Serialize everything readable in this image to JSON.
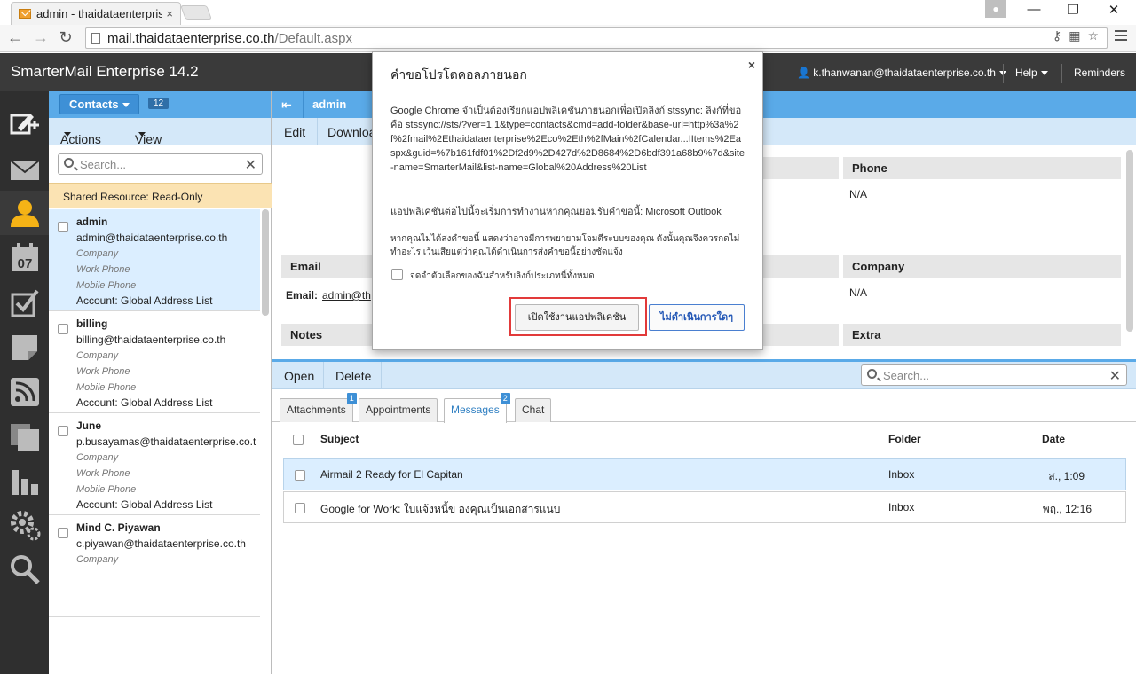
{
  "browser": {
    "tab_title": "admin - thaidataenterprise",
    "tab_close": "×",
    "url_host": "mail.thaidataenterprise.co.th",
    "url_path": "/Default.aspx"
  },
  "app": {
    "title": "SmarterMail Enterprise 14.2",
    "user": "k.thanwanan@thaidataenterprise.co.th",
    "help": "Help",
    "reminders": "Reminders"
  },
  "rail": {
    "calendar_day": "07"
  },
  "contacts": {
    "button_label": "Contacts",
    "count": "12",
    "actions": "Actions",
    "view": "View",
    "search_placeholder": "Search...",
    "shared_notice": "Shared Resource: Read-Only",
    "items": [
      {
        "name": "admin",
        "email": "admin@thaidataenterprise.co.th",
        "company": "Company",
        "work_phone": "Work Phone",
        "mobile_phone": "Mobile Phone",
        "account": "Account: Global Address List"
      },
      {
        "name": "billing",
        "email": "billing@thaidataenterprise.co.th",
        "company": "Company",
        "work_phone": "Work Phone",
        "mobile_phone": "Mobile Phone",
        "account": "Account: Global Address List"
      },
      {
        "name": "June",
        "email": "p.busayamas@thaidataenterprise.co.t",
        "company": "Company",
        "work_phone": "Work Phone",
        "mobile_phone": "Mobile Phone",
        "account": "Account: Global Address List"
      },
      {
        "name": "Mind C. Piyawan",
        "email": "c.piyawan@thaidataenterprise.co.th",
        "company": "Company",
        "work_phone": "",
        "mobile_phone": "",
        "account": ""
      }
    ]
  },
  "detail": {
    "title": "admin",
    "edit": "Edit",
    "download": "Download",
    "phone_header": "Phone",
    "phone_value": "N/A",
    "email_header": "Email",
    "email_label": "Email:",
    "email_value": "admin@th",
    "company_header": "Company",
    "company_value": "N/A",
    "notes_header": "Notes",
    "extra_header": "Extra"
  },
  "lower": {
    "open": "Open",
    "delete": "Delete",
    "search_placeholder": "Search...",
    "tabs": [
      {
        "label": "Attachments",
        "badge": "1"
      },
      {
        "label": "Appointments",
        "badge": ""
      },
      {
        "label": "Messages",
        "badge": "2"
      },
      {
        "label": "Chat",
        "badge": ""
      }
    ],
    "columns": {
      "subject": "Subject",
      "folder": "Folder",
      "date": "Date"
    },
    "messages": [
      {
        "subject": "Airmail 2 Ready for El Capitan",
        "folder": "Inbox",
        "date": "ส., 1:09"
      },
      {
        "subject": "Google for Work: ใบแจ้งหนี้ข องคุณเป็นเอกสารแนบ",
        "folder": "Inbox",
        "date": "พฤ., 12:16"
      }
    ]
  },
  "dialog": {
    "title": "คำขอโปรโตคอลภายนอก",
    "close": "×",
    "body": "Google Chrome จำเป็นต้องเรียกแอปพลิเคชันภายนอกเพื่อเปิดลิงก์ stssync: ลิงก์ที่ขอคือ stssync://sts/?ver=1.1&type=contacts&cmd=add-folder&base-url=http%3a%2f%2fmail%2Ethaidataenterprise%2Eco%2Eth%2fMain%2fCalendar...IItems%2Easpx&guid=%7b161fdf01%2Df2d9%2D427d%2D8684%2D6bdf391a68b9%7d&site-name=SmarterMail&list-name=Global%20Address%20List",
    "app_line": "แอปพลิเคชันต่อไปนี้จะเริ่มการทำงานหากคุณยอมรับคำขอนี้: Microsoft Outlook",
    "warning": "หากคุณไม่ได้ส่งคำขอนี้ แสดงว่าอาจมีการพยายามโจมตีระบบของคุณ ดังนั้นคุณจึงควรกดไม่ทำอะไร เว้นเสียแต่ว่าคุณได้ดำเนินการส่งคำขอนี้อย่างชัดแจ้ง",
    "remember": "จดจำตัวเลือกของฉันสำหรับลิงก์ประเภทนี้ทั้งหมด",
    "launch": "เปิดใช้งานแอปพลิเคชัน",
    "cancel": "ไม่ดำเนินการใดๆ"
  }
}
